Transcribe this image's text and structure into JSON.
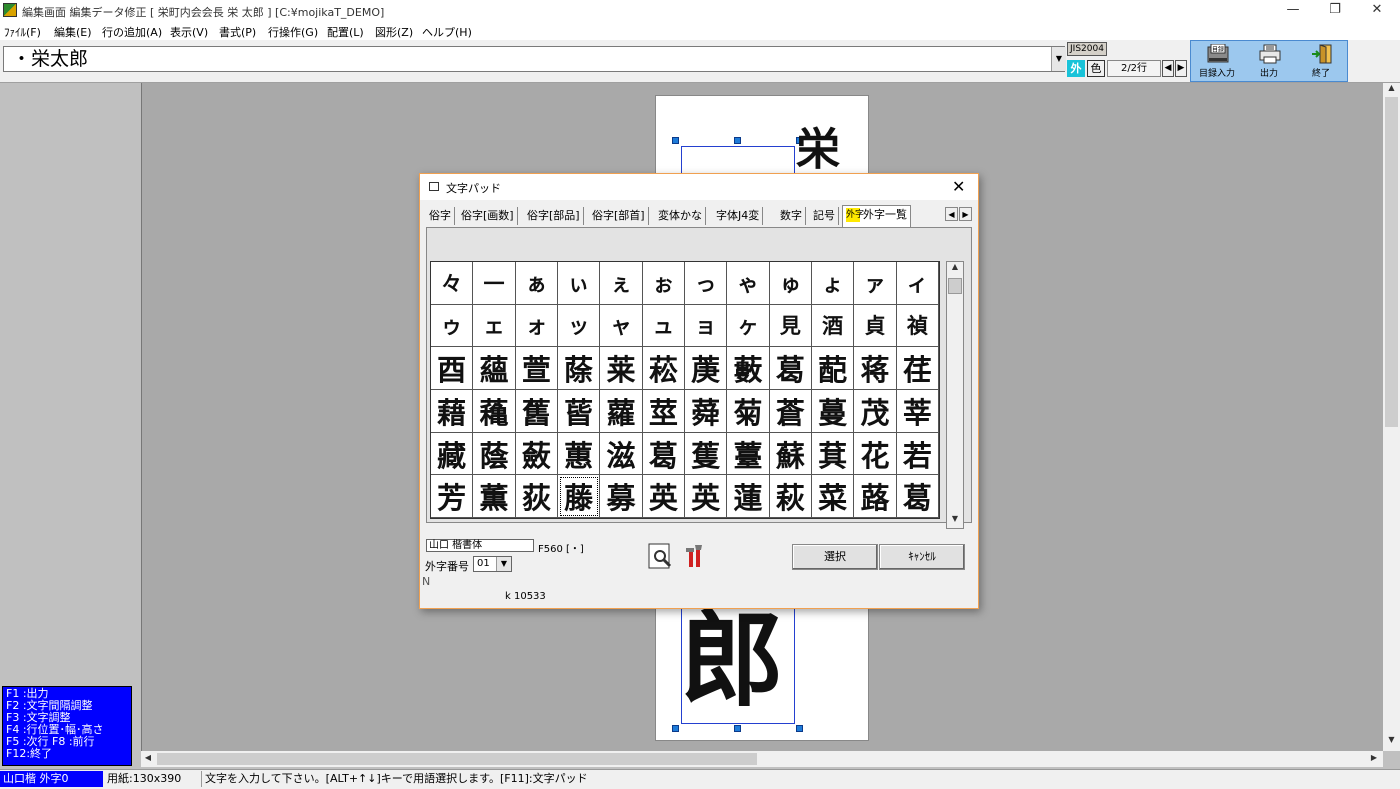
{
  "window": {
    "title": "編集画面  編集データ修正 [ 栄町内会会長 栄 太郎 ]   [C:¥mojikaT_DEMO]",
    "minimize": "—",
    "restore": "❐",
    "close": "✕"
  },
  "menu": [
    "ﾌｧｲﾙ(F)",
    "編集(E)",
    "行の追加(A)",
    "表示(V)",
    "書式(P)",
    "行操作(G)",
    "配置(L)",
    "図形(Z)",
    "ヘルプ(H)"
  ],
  "toolbar": {
    "text_value": "・栄太郎",
    "jis_label": "JIS2004",
    "gaiji_label": "外",
    "color_label": "色",
    "line_indicator": "2/2行",
    "prev": "◀",
    "next": "▶",
    "buttons": [
      {
        "label": "目録入力",
        "icon": "catalog-input-icon"
      },
      {
        "label": "出力",
        "icon": "printer-icon"
      },
      {
        "label": "終了",
        "icon": "exit-door-icon"
      }
    ]
  },
  "canvas": {
    "top_char": "栄",
    "bottom_char": "郎"
  },
  "dialog": {
    "title": "文字パッド",
    "close": "✕",
    "tabs": [
      "俗字",
      "俗字[画数]",
      "俗字[部品]",
      "俗字[部首]",
      "変体かな",
      "字体J4変",
      "数字",
      "記号",
      "外字一覧"
    ],
    "active_tab": "外字一覧",
    "tab_icon_text": "外字",
    "grid": [
      [
        "々",
        "一",
        "ぁ",
        "ぃ",
        "ぇ",
        "ぉ",
        "っ",
        "ゃ",
        "ゅ",
        "ょ",
        "ァ",
        "ィ"
      ],
      [
        "ゥ",
        "ェ",
        "ォ",
        "ッ",
        "ャ",
        "ュ",
        "ョ",
        "ヶ",
        "見",
        "酒",
        "貞",
        "禎"
      ],
      [
        "酉",
        "蘊",
        "萱",
        "蒢",
        "莱",
        "菘",
        "菮",
        "藪",
        "葛",
        "蓜",
        "蒋",
        "荏"
      ],
      [
        "藉",
        "蘒",
        "舊",
        "蒈",
        "蘿",
        "莖",
        "蕣",
        "菊",
        "蒼",
        "蔓",
        "茂",
        "莘"
      ],
      [
        "藏",
        "蔭",
        "蘞",
        "蕙",
        "滋",
        "葛",
        "蒦",
        "薹",
        "蘇",
        "萁",
        "花",
        "若"
      ],
      [
        "芳",
        "薫",
        "荻",
        "藤",
        "募",
        "英",
        "英",
        "蓮",
        "萩",
        "菜",
        "蕗",
        "葛"
      ]
    ],
    "small_rows": 2,
    "selected_cell": "5-3",
    "font_name": "山口 楷書体",
    "font_code": "F560 [・]",
    "gaiji_number_label": "外字番号",
    "gaiji_number_value": "01",
    "n_label": "N",
    "k_label": "k 10533",
    "select_button": "選択",
    "cancel_button": "ｷｬﾝｾﾙ"
  },
  "fkeys": [
    "F1 :出力",
    "F2 :文字間隔調整",
    "F3 :文字調整",
    "F4 :行位置･幅･高さ",
    "F5 :次行  F8 :前行",
    "F12:終了"
  ],
  "status": {
    "font": "山口楷 外字0",
    "paper": "用紙:130x390",
    "message": "文字を入力して下さい。[ALT+↑↓]キーで用語選択します。[F11]:文字パッド"
  }
}
